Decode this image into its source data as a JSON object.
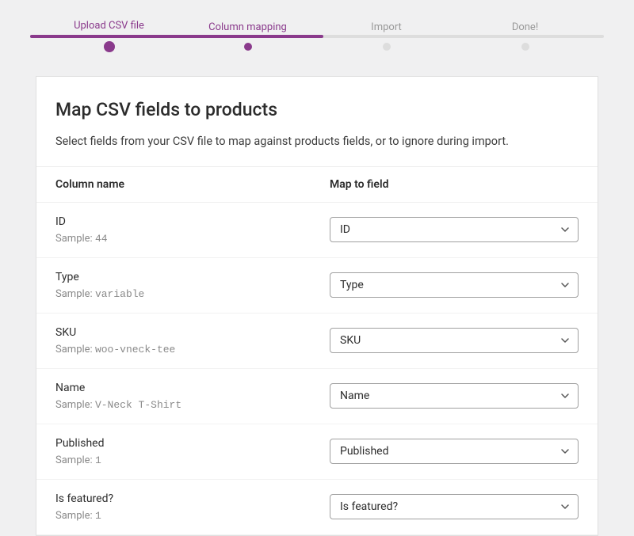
{
  "stepper": {
    "steps": [
      {
        "label": "Upload CSV file"
      },
      {
        "label": "Column mapping"
      },
      {
        "label": "Import"
      },
      {
        "label": "Done!"
      }
    ]
  },
  "header": {
    "title": "Map CSV fields to products",
    "description": "Select fields from your CSV file to map against products fields, or to ignore during import."
  },
  "table": {
    "col_name_header": "Column name",
    "col_map_header": "Map to field",
    "sample_prefix": "Sample:"
  },
  "rows": [
    {
      "name": "ID",
      "sample": "44",
      "map": "ID"
    },
    {
      "name": "Type",
      "sample": "variable",
      "map": "Type"
    },
    {
      "name": "SKU",
      "sample": "woo-vneck-tee",
      "map": "SKU"
    },
    {
      "name": "Name",
      "sample": "V-Neck T-Shirt",
      "map": "Name"
    },
    {
      "name": "Published",
      "sample": "1",
      "map": "Published"
    },
    {
      "name": "Is featured?",
      "sample": "1",
      "map": "Is featured?"
    }
  ]
}
